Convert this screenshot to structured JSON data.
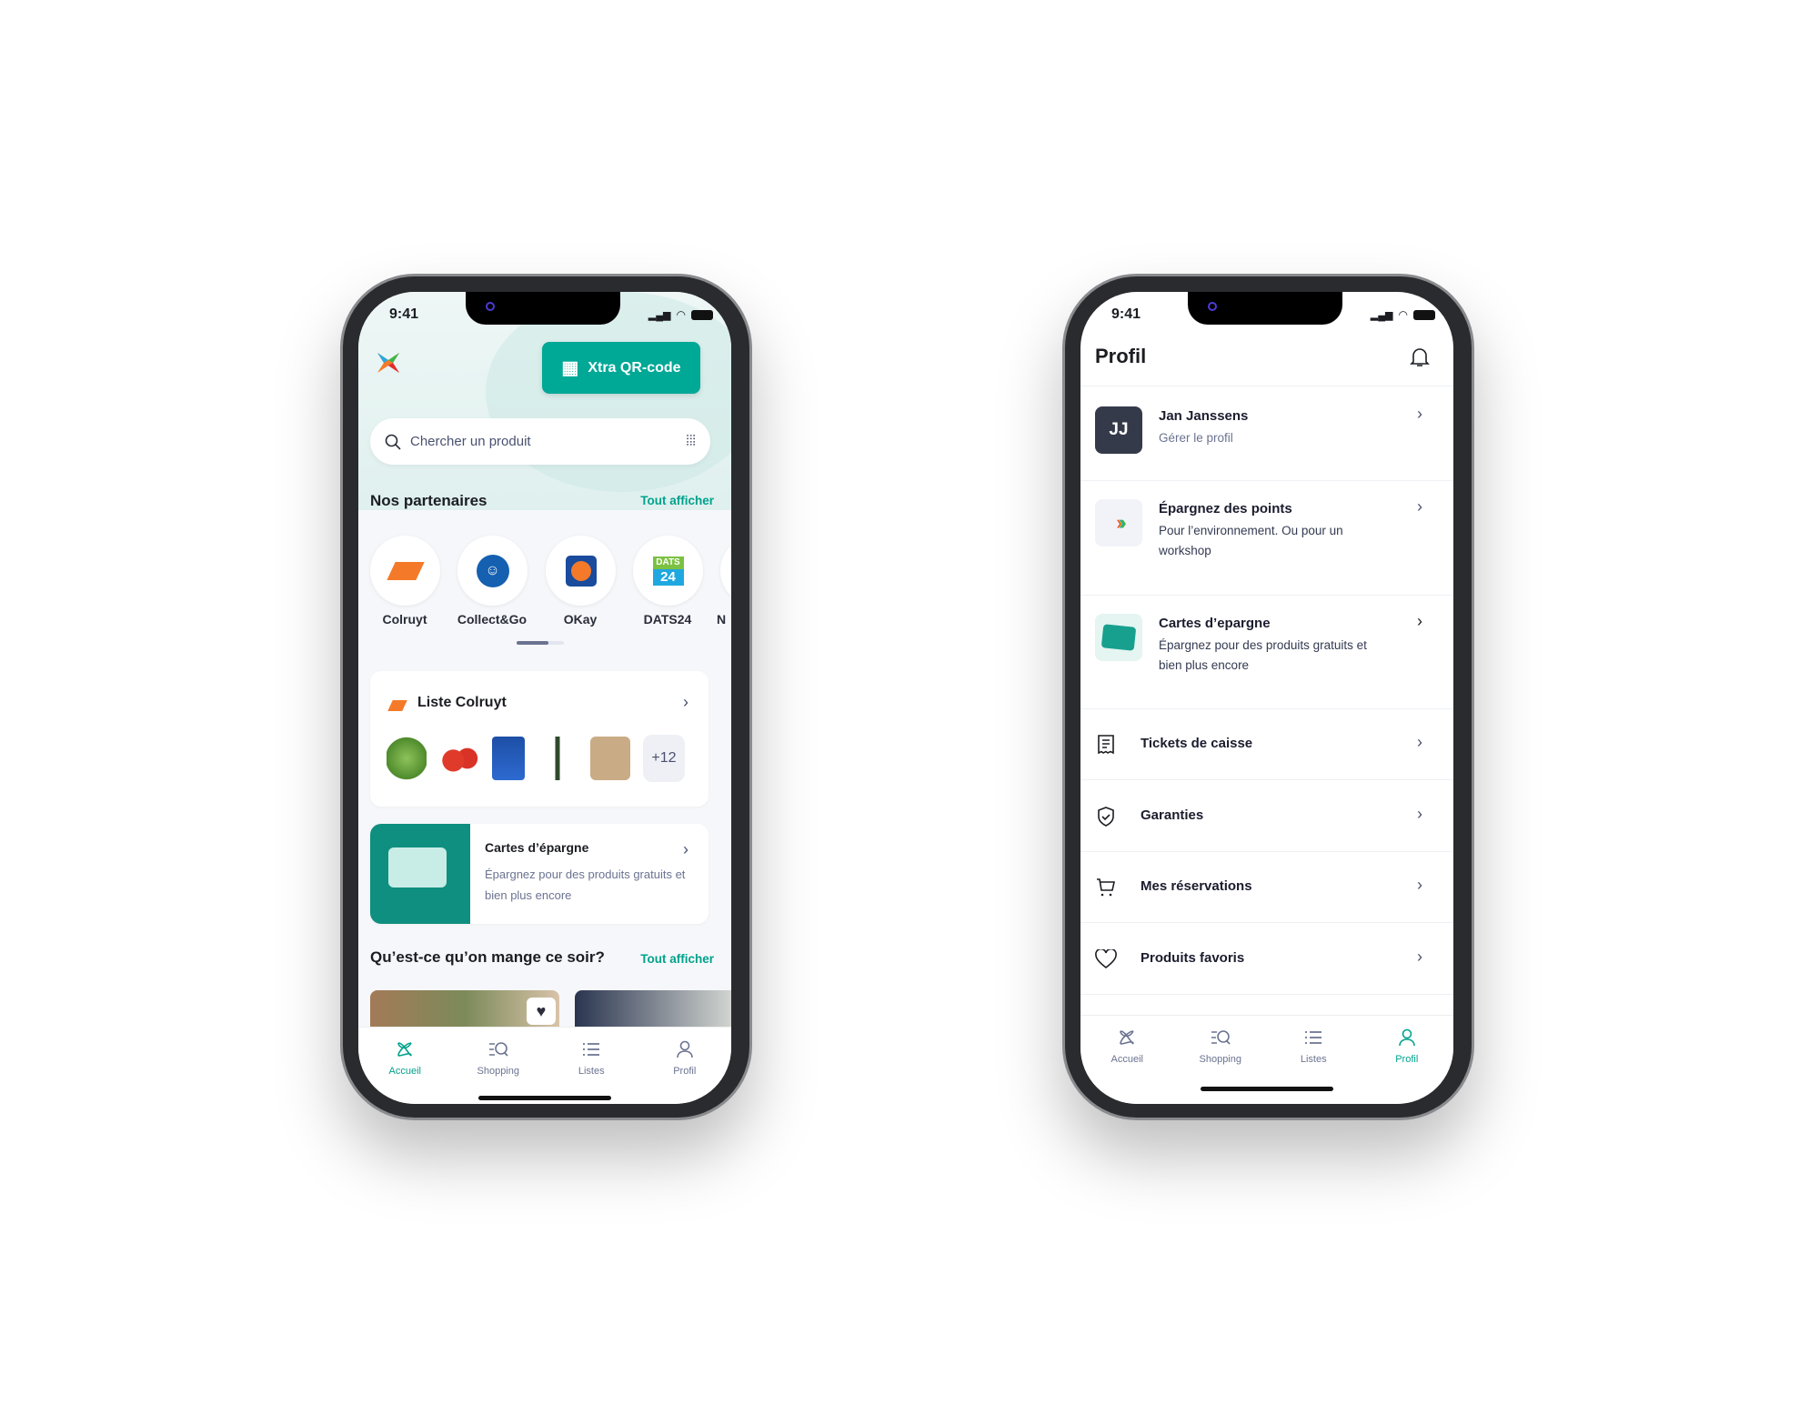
{
  "status": {
    "time": "9:41"
  },
  "home": {
    "qr_button": "Xtra QR-code",
    "search_placeholder": "Chercher un produit",
    "partners": {
      "title": "Nos partenaires",
      "see_all": "Tout afficher",
      "items": [
        {
          "label": "Colruyt"
        },
        {
          "label": "Collect&Go"
        },
        {
          "label": "OKay"
        },
        {
          "label": "DATS24"
        },
        {
          "label": "N"
        }
      ],
      "dats_logo": "DATS 24"
    },
    "list_card": {
      "title": "Liste Colruyt",
      "more": "+12"
    },
    "savings_card": {
      "title": "Cartes d’épargne",
      "subtitle": "Épargnez pour des produits gratuits et bien plus encore"
    },
    "recipes": {
      "title": "Qu’est-ce qu’on mange ce soir?",
      "see_all": "Tout afficher"
    }
  },
  "profile": {
    "title": "Profil",
    "user": {
      "initials": "JJ",
      "name": "Jan Janssens",
      "sub": "Gérer le profil"
    },
    "rows": [
      {
        "title": "Épargnez des points",
        "sub": "Pour l’environnement. Ou pour un workshop"
      },
      {
        "title": "Cartes d’epargne",
        "sub": "Épargnez pour des produits gratuits et bien plus encore"
      },
      {
        "title": "Tickets de caisse",
        "icon": "receipt-icon"
      },
      {
        "title": "Garanties",
        "icon": "shield-check-icon"
      },
      {
        "title": "Mes réservations",
        "icon": "cart-icon"
      },
      {
        "title": "Produits favoris",
        "icon": "heart-icon"
      }
    ]
  },
  "tabs": [
    {
      "label": "Accueil"
    },
    {
      "label": "Shopping"
    },
    {
      "label": "Listes"
    },
    {
      "label": "Profil"
    }
  ],
  "colors": {
    "accent": "#00a28c",
    "colruyt_orange": "#f47a2a"
  }
}
